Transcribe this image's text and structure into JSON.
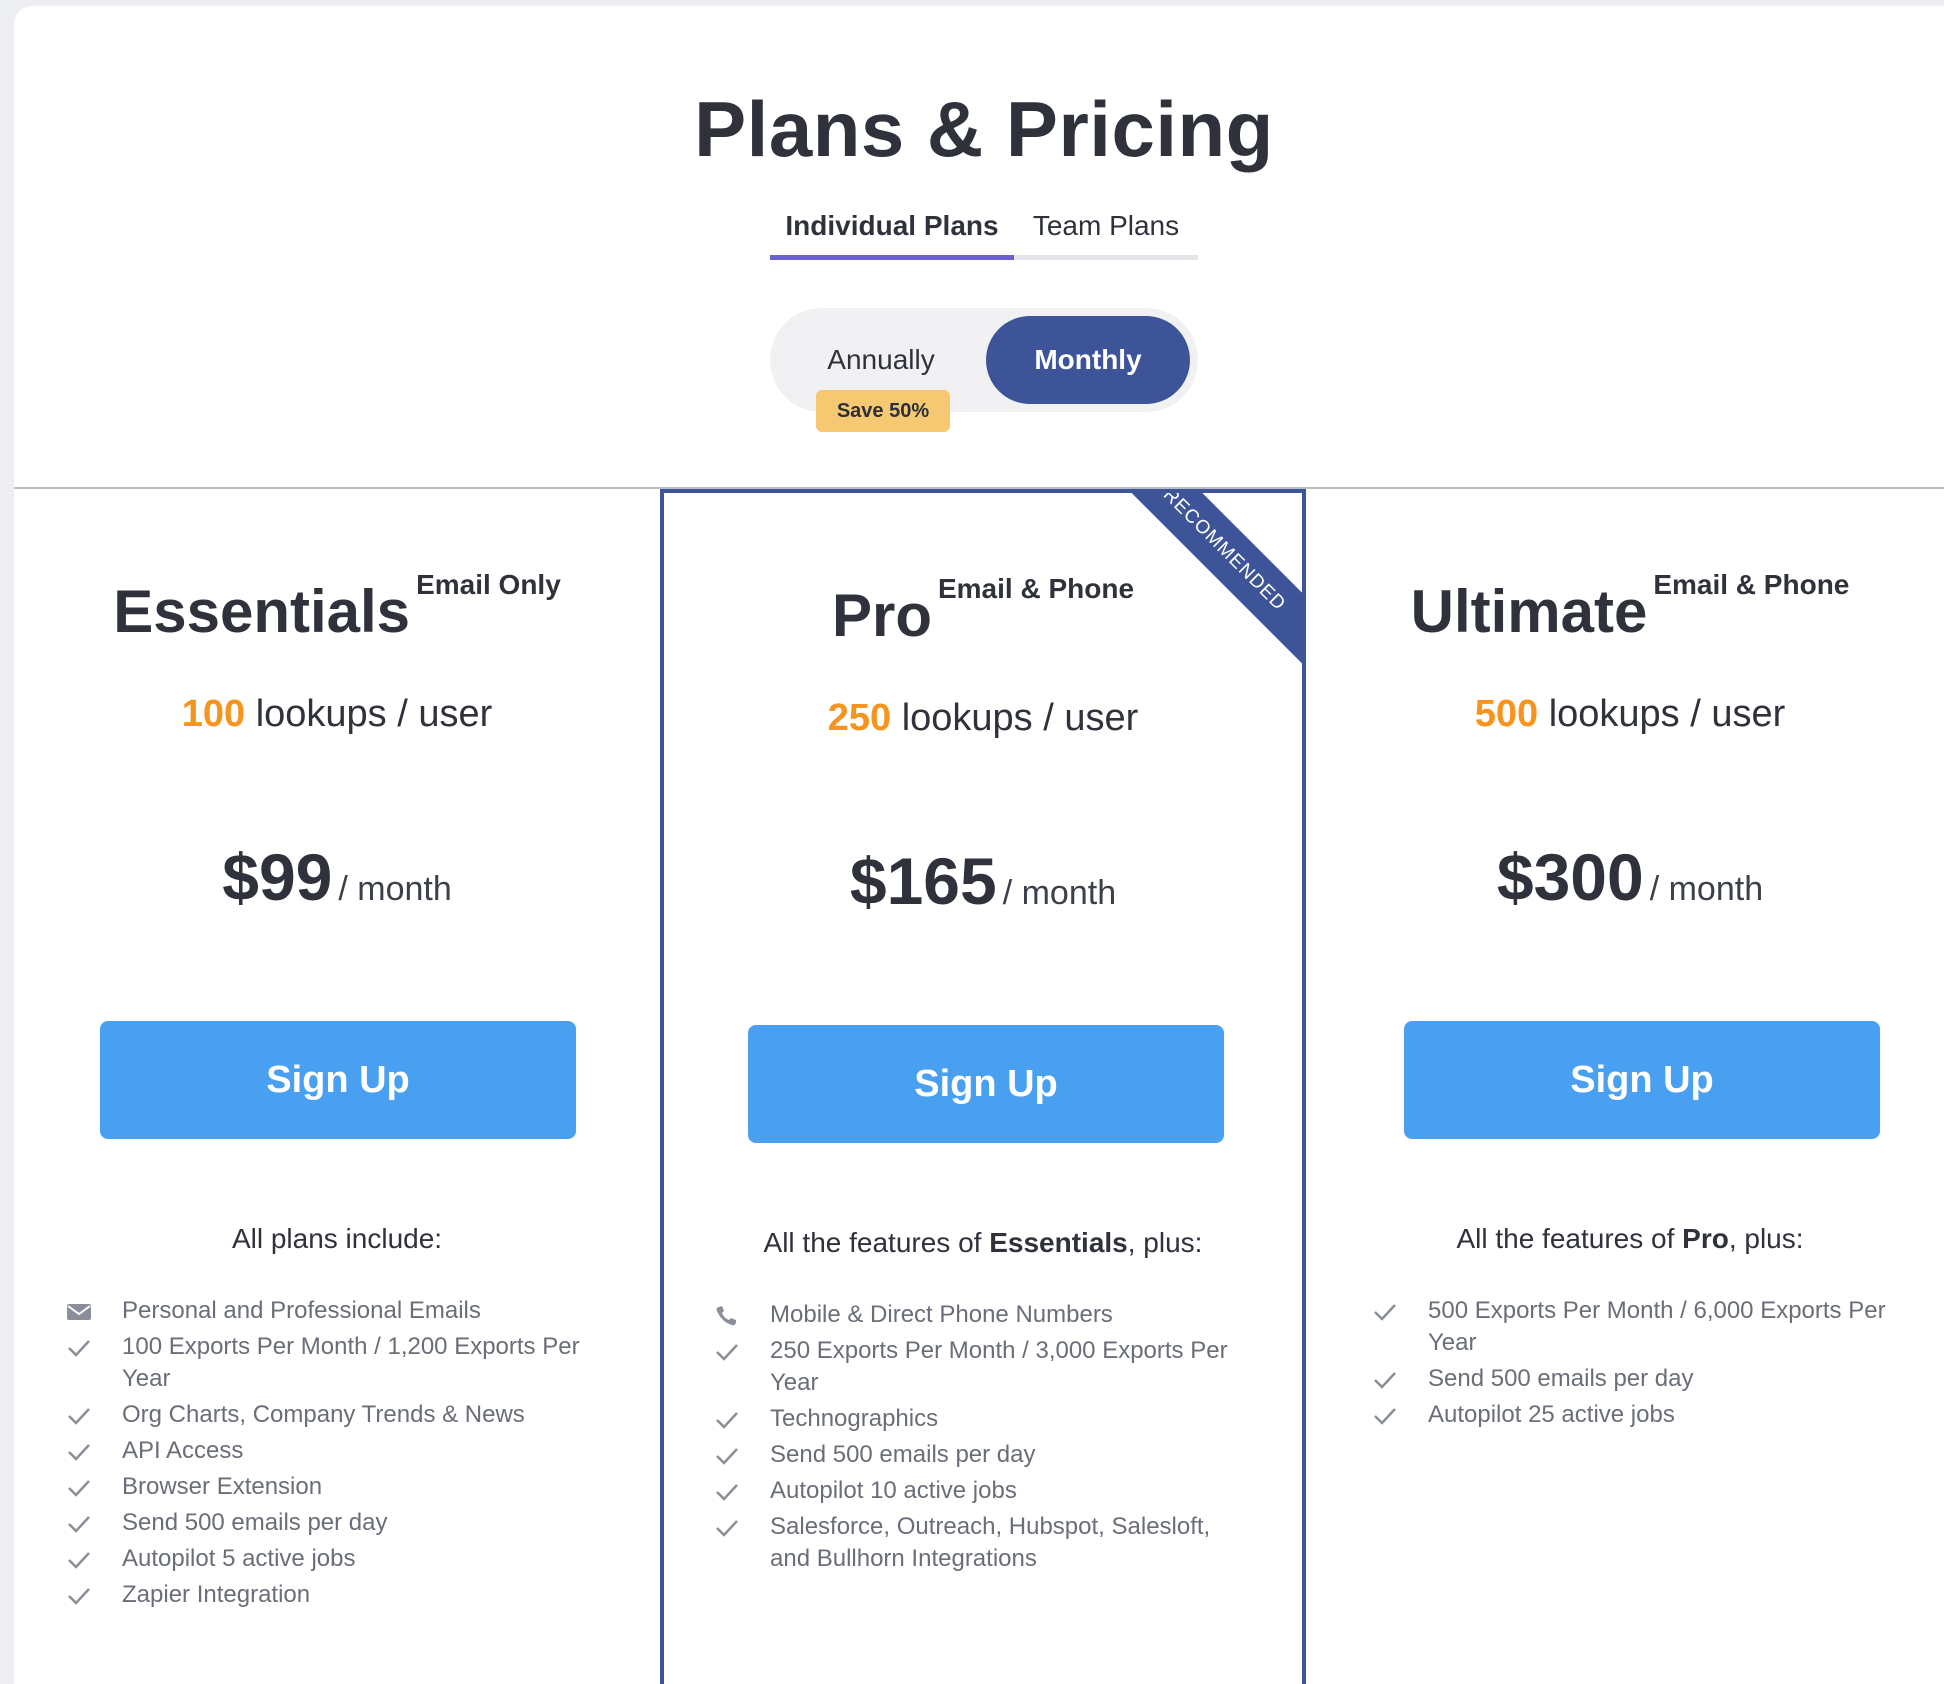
{
  "header": {
    "title": "Plans & Pricing"
  },
  "tabs": [
    {
      "label": "Individual Plans"
    },
    {
      "label": "Team Plans"
    }
  ],
  "billing": {
    "annually": "Annually",
    "monthly": "Monthly",
    "save_badge": "Save 50%"
  },
  "colors": {
    "accent": "#3d5499",
    "button": "#4aa0f0",
    "highlight": "#f7941d",
    "badge": "#f7c872"
  },
  "plans": [
    {
      "name": "Essentials",
      "tag": "Email Only",
      "lookups": "100",
      "lookups_text": "lookups / user",
      "price": "$99",
      "period": "/ month",
      "button": "Sign Up",
      "features_title": "All plans include:",
      "features": [
        "Personal and Professional Emails",
        "100 Exports Per Month / 1,200 Exports Per Year",
        "Org Charts, Company Trends & News",
        "API Access",
        "Browser Extension",
        "Send 500 emails per day",
        "Autopilot 5 active jobs",
        "Zapier Integration"
      ]
    },
    {
      "name": "Pro",
      "tag": "Email & Phone",
      "lookups": "250",
      "lookups_text": "lookups / user",
      "price": "$165",
      "period": "/ month",
      "button": "Sign Up",
      "ribbon": "RECOMMENDED",
      "features_prefix": "All the features of ",
      "features_bold": "Essentials",
      "features_suffix": ", plus:",
      "features": [
        "Mobile & Direct Phone Numbers",
        "250 Exports Per Month / 3,000 Exports Per Year",
        "Technographics",
        "Send 500 emails per day",
        "Autopilot 10 active jobs",
        "Salesforce, Outreach, Hubspot, Salesloft, and Bullhorn Integrations"
      ]
    },
    {
      "name": "Ultimate",
      "tag": "Email & Phone",
      "lookups": "500",
      "lookups_text": "lookups / user",
      "price": "$300",
      "period": "/ month",
      "button": "Sign Up",
      "features_prefix": "All the features of ",
      "features_bold": "Pro",
      "features_suffix": ", plus:",
      "features": [
        "500 Exports Per Month / 6,000 Exports Per Year",
        "Send 500 emails per day",
        "Autopilot 25 active jobs"
      ]
    }
  ]
}
